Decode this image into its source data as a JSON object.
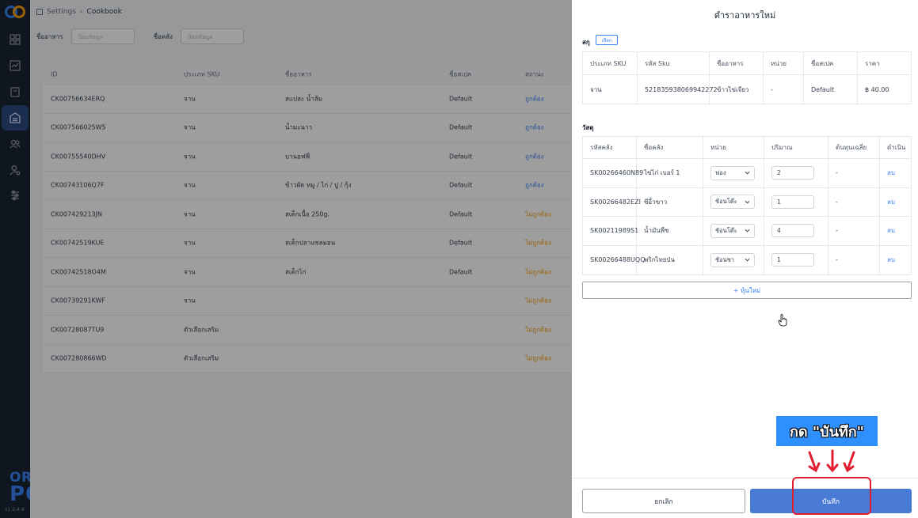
{
  "breadcrumb": {
    "root": "Settings",
    "current": "Cookbook"
  },
  "filters": [
    {
      "label": "ชื่ออาหาร",
      "placeholder": "ป้อนข้อมูล"
    },
    {
      "label": "ชื่อคลัง",
      "placeholder": "ป้อนข้อมูล"
    }
  ],
  "table": {
    "headers": [
      "ID",
      "ประเภท SKU",
      "ชื่ออาหาร",
      "ชื่อสเปค",
      "สถานะ"
    ],
    "rows": [
      {
        "id": "CK00756634ERQ",
        "sku": "จาน",
        "name": "สแปละ น้ำส้ม",
        "spec": "Default",
        "status": "ถูกต้อง",
        "ok": true
      },
      {
        "id": "CK007566025W5",
        "sku": "จาน",
        "name": "น้ำมะนาว",
        "spec": "Default",
        "status": "ถูกต้อง",
        "ok": true
      },
      {
        "id": "CK00755540DHV",
        "sku": "จาน",
        "name": "บานอฟฟี่",
        "spec": "Default",
        "status": "ถูกต้อง",
        "ok": true
      },
      {
        "id": "CK00743106Q7F",
        "sku": "จาน",
        "name": "ข้าวผัด หมู / ไก่ / ปู / กุ้ง",
        "spec": "Default",
        "status": "ถูกต้อง",
        "ok": true
      },
      {
        "id": "CK007429213JN",
        "sku": "จาน",
        "name": "สเต็กเนื้อ 250g.",
        "spec": "Default",
        "status": "ไม่ถูกต้อง",
        "ok": false
      },
      {
        "id": "CK00742519KUE",
        "sku": "จาน",
        "name": "สเต็กปลาแซลมอน",
        "spec": "Default",
        "status": "ไม่ถูกต้อง",
        "ok": false
      },
      {
        "id": "CK00742518O4M",
        "sku": "จาน",
        "name": "สเต็กไก่",
        "spec": "Default",
        "status": "ไม่ถูกต้อง",
        "ok": false
      },
      {
        "id": "CK00739291KWF",
        "sku": "จาน",
        "name": "",
        "spec": "",
        "status": "ไม่ถูกต้อง",
        "ok": false
      },
      {
        "id": "CK00728087TU9",
        "sku": "ตัวเลือกเสริม",
        "name": "",
        "spec": "",
        "status": "ไม่ถูกต้อง",
        "ok": false
      },
      {
        "id": "CK007280866WD",
        "sku": "ตัวเลือกเสริม",
        "name": "",
        "spec": "",
        "status": "ไม่ถูกต้อง",
        "ok": false
      }
    ]
  },
  "drawer": {
    "title": "ตำราอาหารใหม่",
    "sku_label": "สกุ",
    "pick_label": "เลือก",
    "sku_headers": [
      "ประเภท SKU",
      "รหัส Sku",
      "ชื่ออาหาร",
      "หน่วย",
      "ชื่อสเปค",
      "ราคา"
    ],
    "sku_row": [
      "จาน",
      "521835938069942272",
      "ข้าวไข่เจียว",
      "-",
      "Default",
      "฿ 40.00"
    ],
    "material_label": "วัสดุ",
    "mat_headers": [
      "รหัสคลัง",
      "ชื่อคลัง",
      "หน่วย",
      "ปริมาณ",
      "ต้นทุนเฉลี่ย",
      "ดำเนิน"
    ],
    "mat_rows": [
      {
        "code": "SK00266460N89",
        "name": "ไข่ไก่ เบอร์ 1",
        "unit": "ฟอง",
        "qty": "2",
        "cost": "-",
        "action": "ลบ"
      },
      {
        "code": "SK00266482EZI",
        "name": "ซีอิ้วขาว",
        "unit": "ช้อนโต๊ะ",
        "qty": "1",
        "cost": "-",
        "action": "ลบ"
      },
      {
        "code": "SK00211989S1",
        "name": "น้ำมันพืช",
        "unit": "ช้อนโต๊ะ",
        "qty": "4",
        "cost": "-",
        "action": "ลบ"
      },
      {
        "code": "SK00266488UQQ",
        "name": "พริกไทยป่น",
        "unit": "ช้อนชา",
        "qty": "1",
        "cost": "-",
        "action": "ลบ"
      }
    ],
    "add_label": "+ หุ้นใหม่",
    "cancel_label": "ยกเลิก",
    "save_label": "บันทึก"
  },
  "annotation": {
    "text": "กด \"บันทึก\""
  },
  "brand": {
    "line1": "ORDER",
    "line2": "POS"
  },
  "version": "v1.2.4.4",
  "colors": {
    "sidebar": "#1b2535",
    "accent": "#3b82f6",
    "save": "#4a7bd4",
    "warn": "#f59e0b",
    "highlight": "#e11d2f"
  }
}
